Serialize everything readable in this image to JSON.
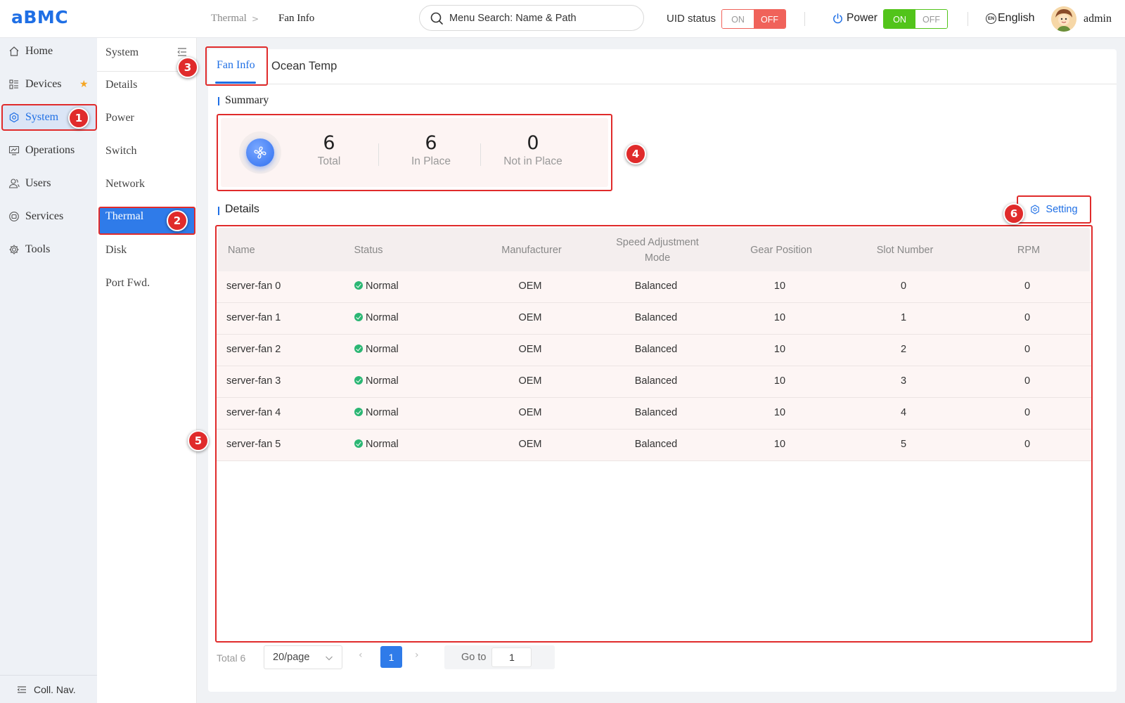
{
  "app": {
    "logo": "aBMC"
  },
  "breadcrumb": {
    "parent": "Thermal",
    "separator": ">",
    "current": "Fan Info"
  },
  "search": {
    "placeholder": "Menu Search: Name & Path"
  },
  "uid": {
    "label": "UID status",
    "on": "ON",
    "off": "OFF",
    "state": "OFF"
  },
  "power": {
    "label": "Power",
    "on": "ON",
    "off": "OFF",
    "state": "ON"
  },
  "language": {
    "icon_text": "EN",
    "label": "English"
  },
  "user": {
    "name": "admin"
  },
  "sidebar": {
    "items": [
      {
        "label": "Home",
        "icon": "home-icon"
      },
      {
        "label": "Devices",
        "icon": "devices-icon"
      },
      {
        "label": "System",
        "icon": "system-icon"
      },
      {
        "label": "Operations",
        "icon": "operations-icon"
      },
      {
        "label": "Users",
        "icon": "users-icon"
      },
      {
        "label": "Services",
        "icon": "services-icon"
      },
      {
        "label": "Tools",
        "icon": "tools-icon"
      }
    ],
    "active": "System",
    "collapse_label": "Coll. Nav."
  },
  "subnav": {
    "title": "System",
    "items": [
      "Details",
      "Power",
      "Switch",
      "Network",
      "Thermal",
      "Disk",
      "Port Fwd."
    ],
    "active": "Thermal"
  },
  "tabs": [
    {
      "label": "Fan Info",
      "active": true
    },
    {
      "label": "Ocean Temp",
      "active": false
    }
  ],
  "summary": {
    "title": "Summary",
    "stats": [
      {
        "value": "6",
        "label": "Total"
      },
      {
        "value": "6",
        "label": "In Place"
      },
      {
        "value": "0",
        "label": "Not in Place"
      }
    ]
  },
  "details": {
    "title": "Details",
    "setting_label": "Setting",
    "columns": [
      "Name",
      "Status",
      "Manufacturer",
      "Speed Adjustment Mode",
      "Gear Position",
      "Slot Number",
      "RPM"
    ],
    "rows": [
      {
        "name": "server-fan 0",
        "status": "Normal",
        "manufacturer": "OEM",
        "mode": "Balanced",
        "gear": "10",
        "slot": "0",
        "rpm": "0"
      },
      {
        "name": "server-fan 1",
        "status": "Normal",
        "manufacturer": "OEM",
        "mode": "Balanced",
        "gear": "10",
        "slot": "1",
        "rpm": "0"
      },
      {
        "name": "server-fan 2",
        "status": "Normal",
        "manufacturer": "OEM",
        "mode": "Balanced",
        "gear": "10",
        "slot": "2",
        "rpm": "0"
      },
      {
        "name": "server-fan 3",
        "status": "Normal",
        "manufacturer": "OEM",
        "mode": "Balanced",
        "gear": "10",
        "slot": "3",
        "rpm": "0"
      },
      {
        "name": "server-fan 4",
        "status": "Normal",
        "manufacturer": "OEM",
        "mode": "Balanced",
        "gear": "10",
        "slot": "4",
        "rpm": "0"
      },
      {
        "name": "server-fan 5",
        "status": "Normal",
        "manufacturer": "OEM",
        "mode": "Balanced",
        "gear": "10",
        "slot": "5",
        "rpm": "0"
      }
    ]
  },
  "pagination": {
    "total": "Total 6",
    "page_size": "20/page",
    "current_page": "1",
    "goto_label": "Go to",
    "goto_value": "1"
  },
  "callouts": [
    "1",
    "2",
    "3",
    "4",
    "5",
    "6"
  ],
  "colors": {
    "accent": "#1f6fe5",
    "highlight": "#e02b2b",
    "success": "#52c41a",
    "uid_off": "#f0625a",
    "ok": "#2bb673"
  }
}
